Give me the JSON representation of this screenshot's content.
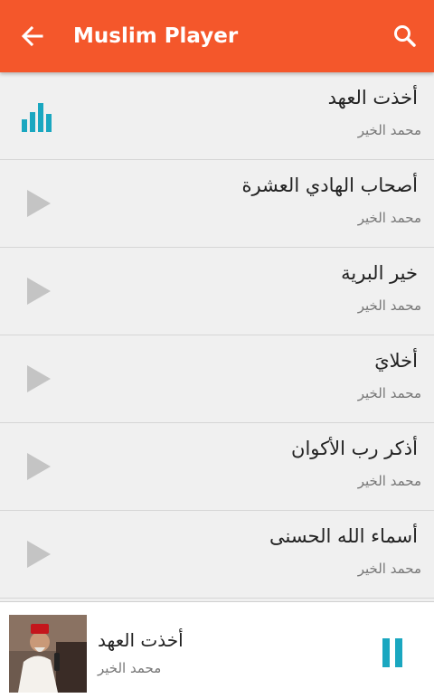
{
  "app_bar": {
    "title": "Muslim Player",
    "back_icon": "arrow-back-icon",
    "search_icon": "search-icon",
    "color": "#f4572b"
  },
  "tracks": [
    {
      "title": "أخذت العهد",
      "artist": "محمد الخير",
      "status_icon": "equalizer-icon",
      "playing": true
    },
    {
      "title": "أصحاب الهادي العشرة",
      "artist": "محمد الخير",
      "status_icon": "play-icon",
      "playing": false
    },
    {
      "title": "خير البرية",
      "artist": "محمد الخير",
      "status_icon": "play-icon",
      "playing": false
    },
    {
      "title": "أخلايَ",
      "artist": "محمد الخير",
      "status_icon": "play-icon",
      "playing": false
    },
    {
      "title": "أذكر رب الأكوان",
      "artist": "محمد الخير",
      "status_icon": "play-icon",
      "playing": false
    },
    {
      "title": "أسماء الله الحسنى",
      "artist": "محمد الخير",
      "status_icon": "play-icon",
      "playing": false
    }
  ],
  "now_playing": {
    "title": "أخذت العهد",
    "artist": "محمد الخير",
    "control_icon": "pause-icon",
    "accent": "#1aa7c0"
  }
}
